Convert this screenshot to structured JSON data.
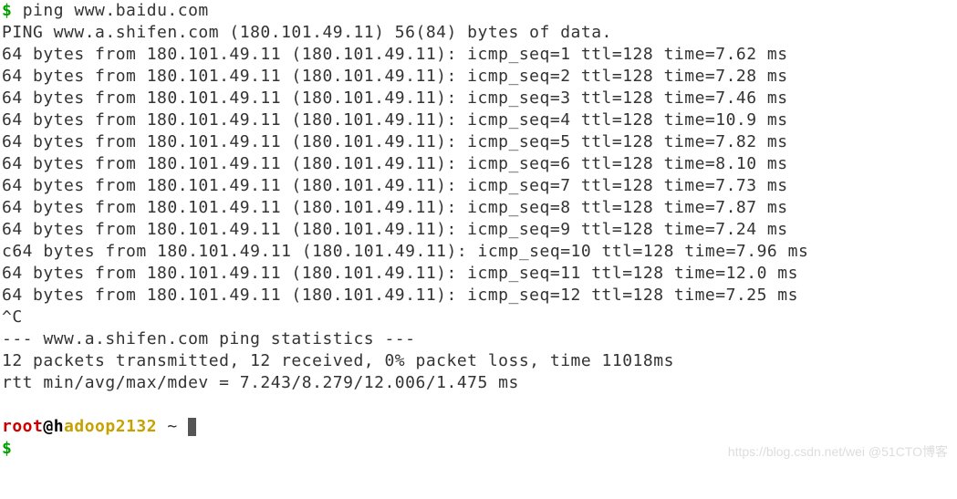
{
  "prompt_char": "$",
  "command": "ping www.baidu.com",
  "header_line": "PING www.a.shifen.com (180.101.49.11) 56(84) bytes of data.",
  "replies": [
    "64 bytes from 180.101.49.11 (180.101.49.11): icmp_seq=1 ttl=128 time=7.62 ms",
    "64 bytes from 180.101.49.11 (180.101.49.11): icmp_seq=2 ttl=128 time=7.28 ms",
    "64 bytes from 180.101.49.11 (180.101.49.11): icmp_seq=3 ttl=128 time=7.46 ms",
    "64 bytes from 180.101.49.11 (180.101.49.11): icmp_seq=4 ttl=128 time=10.9 ms",
    "64 bytes from 180.101.49.11 (180.101.49.11): icmp_seq=5 ttl=128 time=7.82 ms",
    "64 bytes from 180.101.49.11 (180.101.49.11): icmp_seq=6 ttl=128 time=8.10 ms",
    "64 bytes from 180.101.49.11 (180.101.49.11): icmp_seq=7 ttl=128 time=7.73 ms",
    "64 bytes from 180.101.49.11 (180.101.49.11): icmp_seq=8 ttl=128 time=7.87 ms",
    "64 bytes from 180.101.49.11 (180.101.49.11): icmp_seq=9 ttl=128 time=7.24 ms",
    "c64 bytes from 180.101.49.11 (180.101.49.11): icmp_seq=10 ttl=128 time=7.96 ms",
    "64 bytes from 180.101.49.11 (180.101.49.11): icmp_seq=11 ttl=128 time=12.0 ms",
    "64 bytes from 180.101.49.11 (180.101.49.11): icmp_seq=12 ttl=128 time=7.25 ms"
  ],
  "ctrl_c": "^C",
  "stats_header": "--- www.a.shifen.com ping statistics ---",
  "stats_packets": "12 packets transmitted, 12 received, 0% packet loss, time 11018ms",
  "stats_rtt": "rtt min/avg/max/mdev = 7.243/8.279/12.006/1.475 ms",
  "prompt2": {
    "user": "root",
    "at": "@",
    "host1": "h",
    "host2": "adoop",
    "host3": "2132",
    "tilde": " ~"
  },
  "prompt3_char": "$",
  "watermark": "https://blog.csdn.net/wei @51CTO博客"
}
